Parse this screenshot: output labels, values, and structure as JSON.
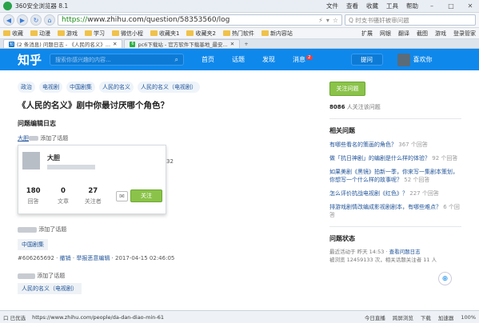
{
  "browser": {
    "title": "360安全浏览器 8.1",
    "menus": [
      "文件",
      "查看",
      "收藏",
      "工具",
      "帮助"
    ],
    "url_scheme": "https://",
    "url_host": "www.zhihu.com",
    "url_path": "/question/58353560/log",
    "search_placeholder": "Q 时支书骚奸被审问题"
  },
  "bookmarks": {
    "items": [
      "收藏",
      "动漫",
      "游戏",
      "学习",
      "微信小程",
      "收藏夹1",
      "收藏夹2",
      "热门软件",
      "新内容站"
    ],
    "right": [
      "扩展",
      "网银",
      "翻译",
      "截图",
      "游戏",
      "登录管家"
    ]
  },
  "tabs": [
    {
      "label": "(2 条消息) 问题日志 - 《人民的名义》...",
      "icon": "知"
    },
    {
      "label": "pc6下载站 - 官方软件下载基地_最安...",
      "icon": "6"
    }
  ],
  "zhihu": {
    "logo": "知乎",
    "search_placeholder": "搜索你感兴趣的内容...",
    "nav": [
      "首页",
      "话题",
      "发现",
      "消息"
    ],
    "msg_badge": "2",
    "ask": "提问",
    "user": "喜欢你"
  },
  "question": {
    "topics": [
      "政治",
      "电视剧",
      "中国剧集",
      "人民的名义",
      "人民的名义（电视剧）"
    ],
    "title": "《人民的名义》剧中你最讨厌哪个角色？",
    "log_heading": "问题编辑日志",
    "log1_user": "大胆",
    "log1_action": "添加了话题",
    "log2_action": "添加了话题",
    "log2_tag": "中国剧集",
    "log2_meta_id": "#606265692",
    "log2_meta_undo": "撤销",
    "log2_meta_report": "举报恶意编辑",
    "log2_meta_time": "2017-04-15 02:46:05",
    "log3_action": "添加了话题",
    "log3_tag": "人民的名义（电视剧）",
    "log1_fragment": "32"
  },
  "popup": {
    "name": "大胆",
    "stats": [
      {
        "n": "180",
        "l": "回答"
      },
      {
        "n": "0",
        "l": "文章"
      },
      {
        "n": "27",
        "l": "关注者"
      }
    ],
    "follow": "关注"
  },
  "side": {
    "follow_btn": "关注问题",
    "follower_count": "8086",
    "follower_text": "人关注该问题",
    "related_heading": "相关问题",
    "related": [
      {
        "q": "有哪些看名的策画的角色？",
        "c": "367 个回答"
      },
      {
        "q": "做「抗日神剧」的编剧是什么样的体验？",
        "c": "92 个回答"
      },
      {
        "q": "如果美剧《黑镜》拍新一季，你来写一集剧本策划，你想写一个什么样的故事呢？",
        "c": "52 个回答"
      },
      {
        "q": "怎么评价抗战电视剧《红色》？",
        "c": "227 个回答"
      },
      {
        "q": "排游戏剧情改编成影视剧剧本，有哪些难点？",
        "c": "6 个回答"
      }
    ],
    "status_heading": "问题状态",
    "status1": "最近活动于 昨天 14:53 · ",
    "status1_link": "查看问题日志",
    "status2": "被浏览 12459133 次，相关话题关注者 11 人"
  },
  "statusbar": {
    "left": "口 已优选",
    "url": "https://www.zhihu.com/people/da-dan-diao-min-61",
    "right": [
      "今日直播",
      "跨屏浏览",
      "下载",
      "加速器",
      "100%"
    ]
  }
}
